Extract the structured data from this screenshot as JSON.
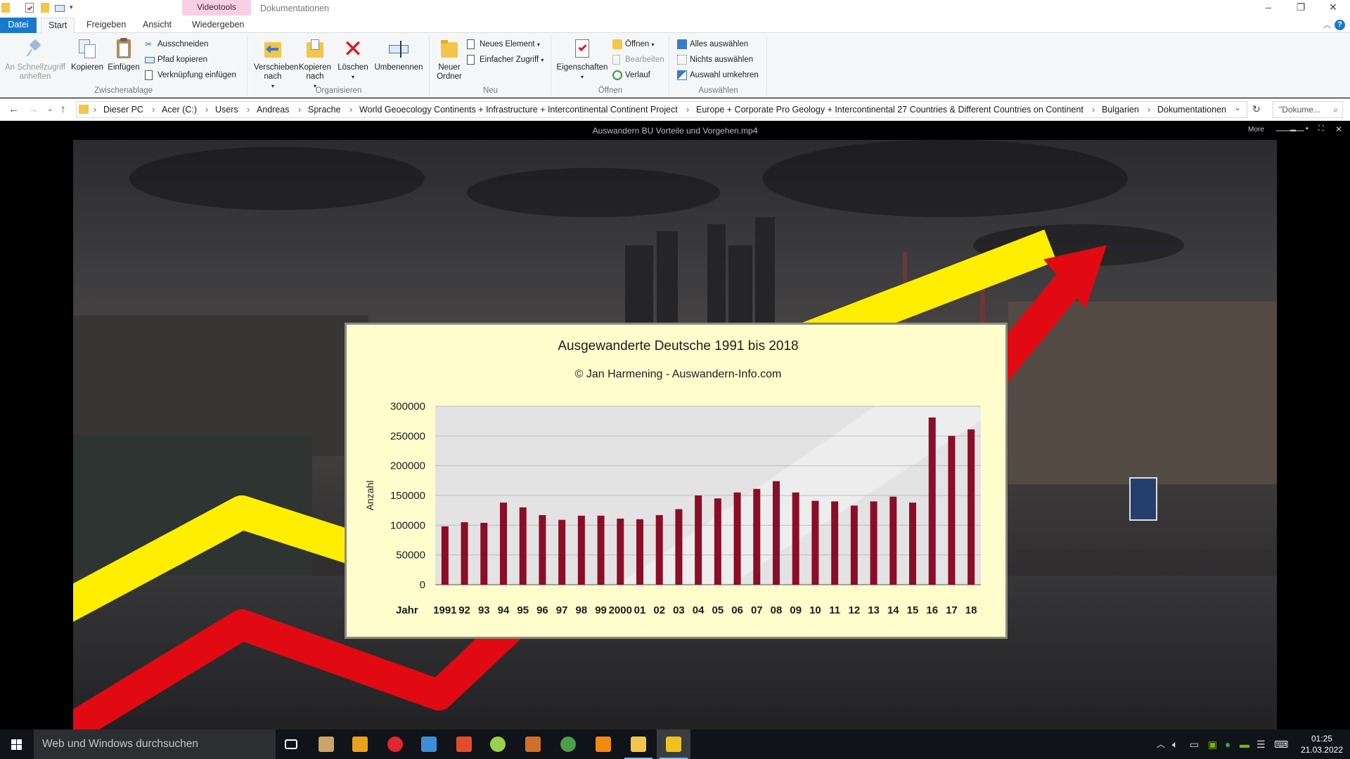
{
  "window": {
    "contextual_group": "Videotools",
    "title": "Dokumentationen",
    "buttons": [
      "–",
      "❐",
      "✕"
    ]
  },
  "tabs": [
    {
      "label": "Datei",
      "kind": "file"
    },
    {
      "label": "Start",
      "kind": "active"
    },
    {
      "label": "Freigeben",
      "kind": "normal"
    },
    {
      "label": "Ansicht",
      "kind": "normal"
    },
    {
      "label": "Wiedergeben",
      "kind": "normal"
    }
  ],
  "ribbon": {
    "clipboard": {
      "label": "Zwischenablage",
      "pin": "An Schnellzugriff anheften",
      "copy": "Kopieren",
      "paste": "Einfügen",
      "cut": "Ausschneiden",
      "copy_path": "Pfad kopieren",
      "paste_shortcut": "Verknüpfung einfügen"
    },
    "organize": {
      "label": "Organisieren",
      "move": "Verschieben nach",
      "copy_to": "Kopieren nach",
      "delete": "Löschen",
      "rename": "Umbenennen"
    },
    "new": {
      "label": "Neu",
      "new_folder": "Neuer Ordner",
      "new_item": "Neues Element",
      "easy_access": "Einfacher Zugriff"
    },
    "open": {
      "label": "Öffnen",
      "properties": "Eigenschaften",
      "open": "Öffnen",
      "edit": "Bearbeiten",
      "history": "Verlauf"
    },
    "select": {
      "label": "Auswählen",
      "select_all": "Alles auswählen",
      "select_none": "Nichts auswählen",
      "invert": "Auswahl umkehren"
    }
  },
  "address": {
    "crumbs": [
      "Dieser PC",
      "Acer (C:)",
      "Users",
      "Andreas",
      "Sprache",
      "World Geoecology Continents + Infrastructure + Intercontinental Continent Project",
      "Europe + Corporate Pro Geology + Intercontinental 27 Countries & Different Countries on Continent",
      "Bulgarien",
      "Dokumentationen"
    ],
    "search_placeholder": "\"Dokume...",
    "refresh": "↻"
  },
  "video": {
    "title": "Auswandern BU Vorteile und Vorgehen.mp4",
    "more": "More",
    "controls": [
      "▬",
      "▪",
      "⛶",
      "✕"
    ]
  },
  "colors": {
    "bar": "#8b0d27",
    "panel": "#fffdcc",
    "red_arrow": "#e10a12",
    "yellow_band": "#ffee00",
    "taskbar": "#101317",
    "file_tab": "#1979ca"
  },
  "chart_data": {
    "type": "bar",
    "title": "Ausgewanderte Deutsche 1991 bis 2018",
    "subtitle": "© Jan Harmening - Auswandern-Info.com",
    "ylabel": "Anzahl",
    "xlabel": "Jahr",
    "ylim": [
      0,
      300000
    ],
    "yticks": [
      "300000",
      "250000",
      "200000",
      "150000",
      "100000",
      "50000",
      "0"
    ],
    "categories": [
      "1991",
      "92",
      "93",
      "94",
      "95",
      "96",
      "97",
      "98",
      "99",
      "2000",
      "01",
      "02",
      "03",
      "04",
      "05",
      "06",
      "07",
      "08",
      "09",
      "10",
      "11",
      "12",
      "13",
      "14",
      "15",
      "16",
      "17",
      "18"
    ],
    "values": [
      98000,
      105000,
      104000,
      138000,
      130000,
      117000,
      109000,
      116000,
      116000,
      111000,
      110000,
      117000,
      127000,
      150000,
      145000,
      155000,
      161000,
      174000,
      155000,
      141000,
      140000,
      133000,
      140000,
      148000,
      138000,
      281000,
      250000,
      261000
    ],
    "grid": true
  },
  "taskbar": {
    "search_placeholder": "Web und Windows durchsuchen",
    "apps": [
      {
        "name": "task-view",
        "color": "#ffffff"
      },
      {
        "name": "file-manager",
        "color": "#caa46a"
      },
      {
        "name": "bird-app",
        "color": "#e8a21e"
      },
      {
        "name": "opera",
        "color": "#e1272f"
      },
      {
        "name": "photos",
        "color": "#3b8fd9"
      },
      {
        "name": "office",
        "color": "#e54b2a"
      },
      {
        "name": "picasa",
        "color": "#9bd14a"
      },
      {
        "name": "image-editor",
        "color": "#cf6f2a"
      },
      {
        "name": "chrome",
        "color": "#4a9f48"
      },
      {
        "name": "vlc",
        "color": "#f28a10"
      },
      {
        "name": "explorer",
        "color": "#f2c64b"
      },
      {
        "name": "media-player",
        "color": "#f0c020"
      }
    ],
    "clock_time": "01:25",
    "clock_date": "21.03.2022"
  }
}
